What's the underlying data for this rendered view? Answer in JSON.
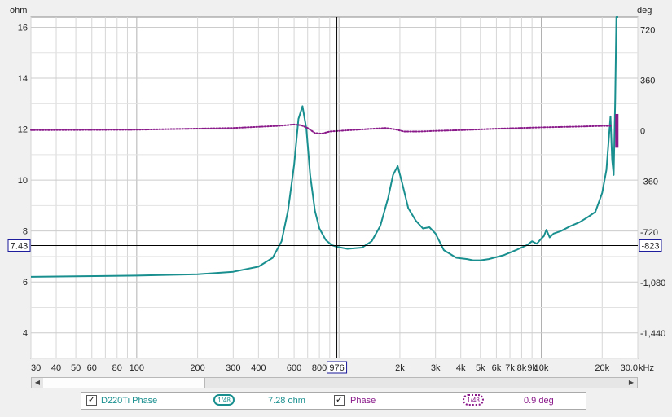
{
  "chart_data": {
    "type": "line",
    "x_axis": {
      "scale": "log",
      "range": [
        30,
        30000
      ],
      "unit_label": "kHz",
      "ticks": [
        {
          "value": 30,
          "label": "30"
        },
        {
          "value": 40,
          "label": "40"
        },
        {
          "value": 50,
          "label": "50"
        },
        {
          "value": 60,
          "label": "60"
        },
        {
          "value": 80,
          "label": "80"
        },
        {
          "value": 100,
          "label": "100"
        },
        {
          "value": 200,
          "label": "200"
        },
        {
          "value": 300,
          "label": "300"
        },
        {
          "value": 400,
          "label": "400"
        },
        {
          "value": 600,
          "label": "600"
        },
        {
          "value": 800,
          "label": "800"
        },
        {
          "value": 2000,
          "label": "2k"
        },
        {
          "value": 3000,
          "label": "3k"
        },
        {
          "value": 4000,
          "label": "4k"
        },
        {
          "value": 5000,
          "label": "5k"
        },
        {
          "value": 6000,
          "label": "6k"
        },
        {
          "value": 7000,
          "label": "7k"
        },
        {
          "value": 8000,
          "label": "8k"
        },
        {
          "value": 9000,
          "label": "9k"
        },
        {
          "value": 10000,
          "label": "10k"
        },
        {
          "value": 20000,
          "label": "20k"
        },
        {
          "value": 30000,
          "label": "30.0"
        }
      ],
      "cursor": {
        "value": 976,
        "label": "976"
      }
    },
    "y_axis_left": {
      "unit_label": "ohm",
      "range": [
        3,
        16.4
      ],
      "ticks": [
        {
          "value": 4,
          "label": "4"
        },
        {
          "value": 6,
          "label": "6"
        },
        {
          "value": 8,
          "label": "8"
        },
        {
          "value": 10,
          "label": "10"
        },
        {
          "value": 12,
          "label": "12"
        },
        {
          "value": 14,
          "label": "14"
        },
        {
          "value": 16,
          "label": "16"
        }
      ],
      "cursor": {
        "value": 7.43,
        "label": "7.43"
      }
    },
    "y_axis_right": {
      "unit_label": "deg",
      "range": [
        -1620,
        810
      ],
      "ticks": [
        {
          "value": 720,
          "label": "720"
        },
        {
          "value": 360,
          "label": "360"
        },
        {
          "value": 0,
          "label": "0"
        },
        {
          "value": -360,
          "label": "-360"
        },
        {
          "value": -720,
          "label": "-720"
        },
        {
          "value": -1080,
          "label": "-1,080"
        },
        {
          "value": -1440,
          "label": "-1,440"
        }
      ],
      "cursor": {
        "value": -823,
        "label": "-823"
      }
    },
    "grid": true,
    "series": [
      {
        "name": "D220Ti Phase",
        "axis": "left",
        "color": "#1a8f8f",
        "style": "solid",
        "x": [
          30,
          50,
          100,
          200,
          300,
          400,
          470,
          520,
          560,
          600,
          630,
          660,
          690,
          720,
          760,
          800,
          860,
          920,
          976,
          1100,
          1300,
          1450,
          1600,
          1750,
          1850,
          1950,
          2050,
          2200,
          2400,
          2600,
          2800,
          3000,
          3300,
          3800,
          4300,
          4600,
          5000,
          5500,
          6500,
          7500,
          8500,
          9000,
          9500,
          10000,
          10300,
          10600,
          11000,
          11500,
          12500,
          14000,
          15500,
          17000,
          18500,
          20000,
          21000,
          22000,
          22400,
          22800,
          23200,
          23500,
          23800,
          24000
        ],
        "y": [
          6.2,
          6.22,
          6.25,
          6.3,
          6.4,
          6.6,
          6.95,
          7.6,
          8.8,
          10.6,
          12.4,
          12.9,
          12.0,
          10.2,
          8.8,
          8.1,
          7.65,
          7.45,
          7.38,
          7.3,
          7.35,
          7.6,
          8.2,
          9.3,
          10.2,
          10.55,
          9.9,
          8.9,
          8.4,
          8.1,
          8.15,
          7.9,
          7.25,
          6.95,
          6.9,
          6.85,
          6.85,
          6.9,
          7.05,
          7.25,
          7.45,
          7.6,
          7.5,
          7.7,
          7.8,
          8.05,
          7.75,
          7.9,
          8.0,
          8.2,
          8.35,
          8.55,
          8.75,
          9.5,
          10.4,
          12.5,
          10.8,
          10.2,
          13.2,
          16.4,
          16.6,
          16.6
        ]
      },
      {
        "name": "Phase",
        "axis": "right",
        "color": "#8a1a8a",
        "style": "dotted",
        "x": [
          30,
          100,
          300,
          500,
          600,
          650,
          700,
          760,
          820,
          900,
          1000,
          1300,
          1700,
          1900,
          2100,
          2500,
          3000,
          4000,
          6000,
          10000,
          15000,
          20000,
          22000
        ],
        "y": [
          5,
          8,
          20,
          35,
          45,
          40,
          20,
          -15,
          -20,
          -5,
          0,
          10,
          20,
          10,
          -5,
          -5,
          0,
          5,
          15,
          25,
          30,
          35,
          35
        ]
      }
    ]
  },
  "legend": {
    "items": [
      {
        "name": "D220Ti Phase",
        "checked": "✓",
        "swatch_label": "1/48",
        "value": "7.28 ohm",
        "color": "#1a8f8f"
      },
      {
        "name": "Phase",
        "checked": "✓",
        "swatch_label": "1/48",
        "value": "0.9 deg",
        "color": "#8a1a8a"
      }
    ]
  },
  "scrollbar": {
    "left_arrow": "◀",
    "right_arrow": "▶"
  }
}
